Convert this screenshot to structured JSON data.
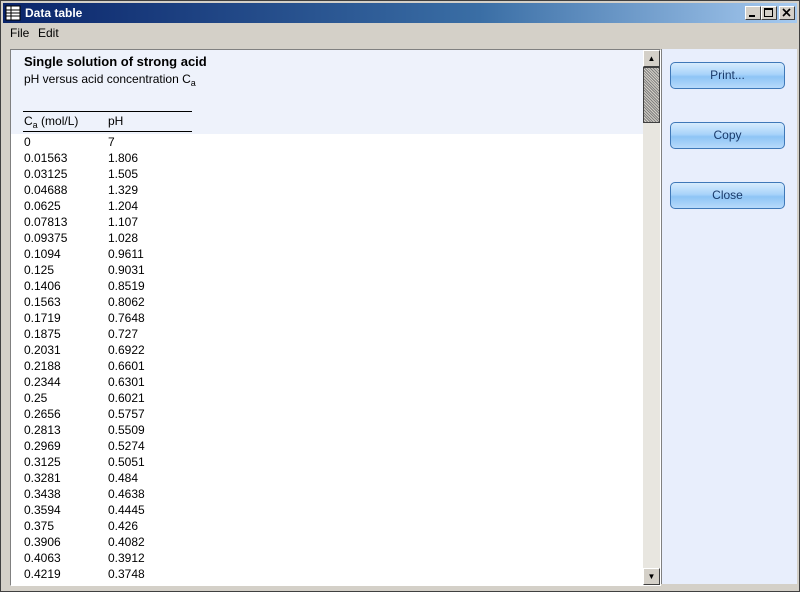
{
  "window": {
    "title": "Data table"
  },
  "menu": {
    "file": "File",
    "edit": "Edit"
  },
  "report": {
    "title": "Single solution of strong acid",
    "subtitle": "pH versus acid concentration C",
    "subtitle_sub": "a"
  },
  "table": {
    "col_a_main": "C",
    "col_a_sub": "a",
    "col_a_rest": " (mol/L)",
    "col_b": "pH",
    "rows": [
      [
        "0",
        "7"
      ],
      [
        "0.01563",
        "1.806"
      ],
      [
        "0.03125",
        "1.505"
      ],
      [
        "0.04688",
        "1.329"
      ],
      [
        "0.0625",
        "1.204"
      ],
      [
        "0.07813",
        "1.107"
      ],
      [
        "0.09375",
        "1.028"
      ],
      [
        "0.1094",
        "0.9611"
      ],
      [
        "0.125",
        "0.9031"
      ],
      [
        "0.1406",
        "0.8519"
      ],
      [
        "0.1563",
        "0.8062"
      ],
      [
        "0.1719",
        "0.7648"
      ],
      [
        "0.1875",
        "0.727"
      ],
      [
        "0.2031",
        "0.6922"
      ],
      [
        "0.2188",
        "0.6601"
      ],
      [
        "0.2344",
        "0.6301"
      ],
      [
        "0.25",
        "0.6021"
      ],
      [
        "0.2656",
        "0.5757"
      ],
      [
        "0.2813",
        "0.5509"
      ],
      [
        "0.2969",
        "0.5274"
      ],
      [
        "0.3125",
        "0.5051"
      ],
      [
        "0.3281",
        "0.484"
      ],
      [
        "0.3438",
        "0.4638"
      ],
      [
        "0.3594",
        "0.4445"
      ],
      [
        "0.375",
        "0.426"
      ],
      [
        "0.3906",
        "0.4082"
      ],
      [
        "0.4063",
        "0.3912"
      ],
      [
        "0.4219",
        "0.3748"
      ]
    ]
  },
  "buttons": {
    "print": "Print...",
    "copy": "Copy",
    "close": "Close"
  },
  "colors": {
    "title_start": "#0a246a",
    "title_end": "#a6caf0",
    "side_panel": "#e8eefc",
    "header_band": "#eef2fb",
    "button_border": "#3f78b8"
  }
}
